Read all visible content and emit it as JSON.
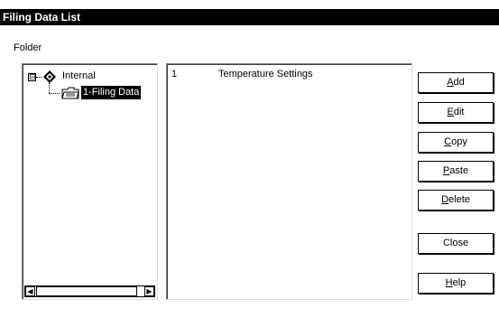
{
  "window": {
    "title": "Filing Data List"
  },
  "folder": {
    "label": "Folder"
  },
  "tree": {
    "root_label": "Internal",
    "expander": "⊟",
    "child_label": "1-Filing Data"
  },
  "list": {
    "rows": [
      {
        "number": "1",
        "name": "Temperature Settings"
      }
    ]
  },
  "buttons": {
    "add": {
      "mnemonic": "A",
      "rest": "dd"
    },
    "edit": {
      "mnemonic": "E",
      "rest": "dit"
    },
    "copy": {
      "mnemonic": "C",
      "rest": "opy"
    },
    "paste": {
      "mnemonic": "P",
      "rest": "aste"
    },
    "delete": {
      "mnemonic": "D",
      "rest": "elete"
    },
    "close": {
      "label": "Close"
    },
    "help": {
      "mnemonic": "H",
      "rest": "elp"
    }
  },
  "icons": {
    "tree_root": "diamond-icon",
    "tree_child": "folder-icon",
    "scroll_left": "◀",
    "scroll_right": "▶"
  }
}
